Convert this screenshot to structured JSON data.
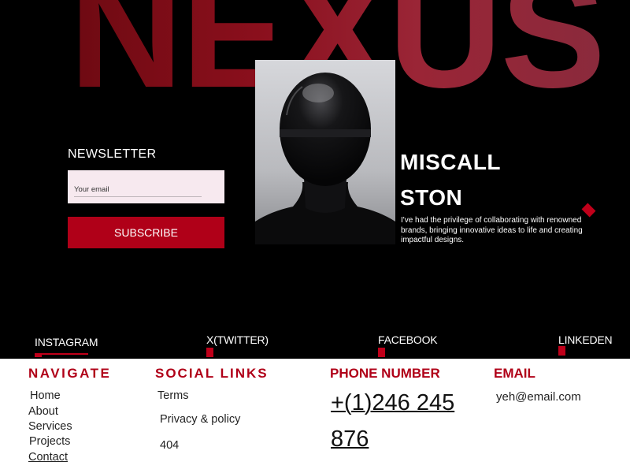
{
  "brand": {
    "name": "NEXUS"
  },
  "newsletter": {
    "title": "NEWSLETTER",
    "email_placeholder": "Your email",
    "subscribe_label": "SUBSCRIBE"
  },
  "profile": {
    "name_line1": "MISCALL",
    "name_line2": "STON",
    "bio": "I've had the privilege of collaborating with renowned brands, bringing innovative ideas to life and creating impactful designs."
  },
  "social_bar": [
    {
      "label": "INSTAGRAM"
    },
    {
      "label": "X(TWITTER)"
    },
    {
      "label": "FACEBOOK"
    },
    {
      "label": "LINKEDEN"
    }
  ],
  "footer": {
    "navigate": {
      "heading": "NAVIGATE",
      "links": [
        "Home",
        "About",
        "Services",
        "Projects",
        "Contact"
      ]
    },
    "social_links": {
      "heading": "SOCIAL LINKS",
      "links": [
        "Terms",
        "Privacy & policy",
        "404"
      ]
    },
    "phone": {
      "heading": "PHONE NUMBER",
      "value": "+(1)246 245 876"
    },
    "email": {
      "heading": "EMAIL",
      "value": "yeh@email.com"
    }
  },
  "colors": {
    "accent": "#b00018",
    "background": "#000000",
    "footer_bg": "#ffffff"
  },
  "icons": [
    "diamond-icon"
  ]
}
